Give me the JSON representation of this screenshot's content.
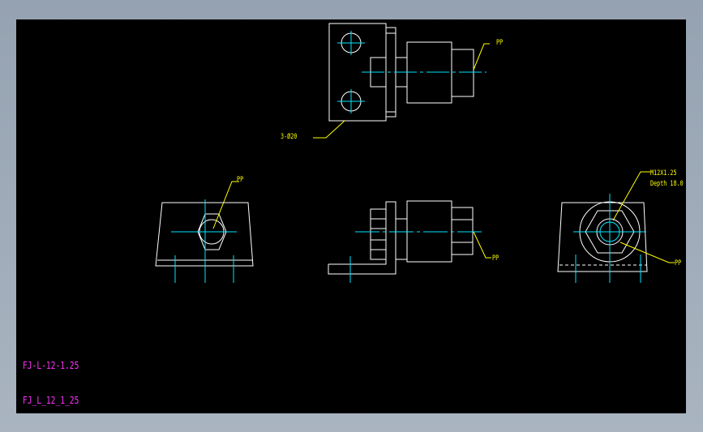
{
  "annotations": {
    "top_pp": "PP",
    "holes": "3-Ø20",
    "front_pp": "PP",
    "side_pp": "PP",
    "thread_spec": "M12X1.25",
    "thread_depth": "Depth 18.0",
    "right_pp": "PP"
  },
  "titles": {
    "part_name": "FJ-L-12-1.25",
    "file_name": "FJ_L_12_1_25"
  },
  "colors": {
    "background": "#000000",
    "outline": "#ffffff",
    "centerline": "#00e5ff",
    "leader": "#ffff00",
    "title_text": "#ff33ff",
    "window_frame": "#a0acb9"
  }
}
